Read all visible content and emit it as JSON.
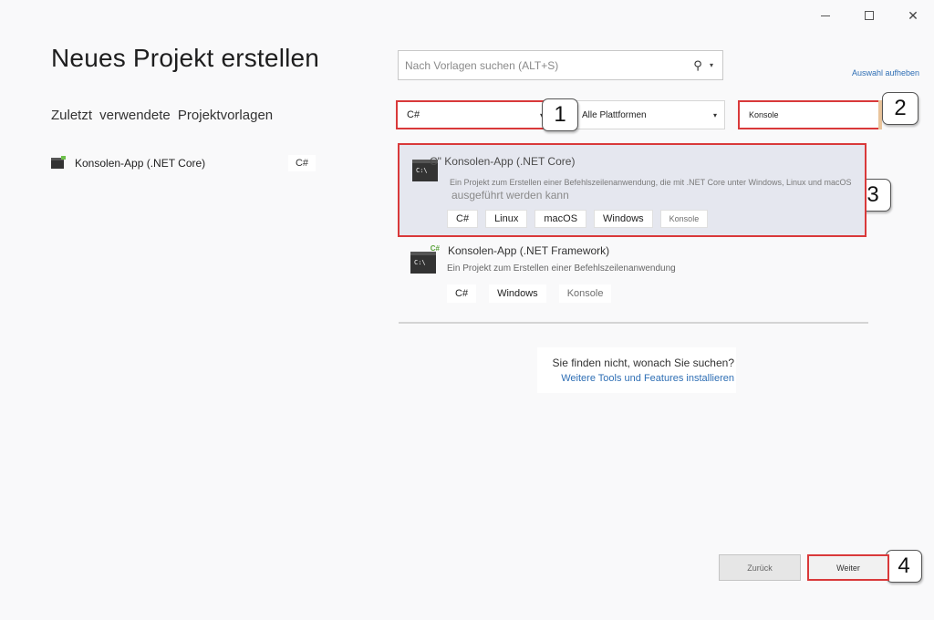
{
  "window": {
    "minimize_icon": "minimize-icon",
    "maximize_icon": "maximize-icon",
    "close_icon": "close-icon",
    "close_glyph": "✕"
  },
  "page": {
    "title": "Neues Projekt erstellen",
    "recent_heading": "Zuletzt verwendete Projektvorlagen"
  },
  "recent": [
    {
      "label": "Konsolen-App (.NET Core)",
      "tag": "C#",
      "icon": "console-app-icon"
    }
  ],
  "search": {
    "placeholder": "Nach Vorlagen suchen (ALT+S)",
    "icon": "search-icon",
    "icon_glyph": "⚲",
    "dropdown_glyph": "▾"
  },
  "clear_selection": "Auswahl aufheben",
  "filters": {
    "language": "C#",
    "platform": "Alle Plattformen",
    "project_type": "Konsole",
    "dropdown_glyph": "▾"
  },
  "callouts": [
    "1",
    "2",
    "3",
    "4"
  ],
  "templates": [
    {
      "title": "C\" Konsolen-App (.NET Core)",
      "description": "Ein Projekt zum Erstellen einer Befehlszeilenanwendung, die mit .NET Core unter Windows, Linux und macOS",
      "description_cont": "ausgeführt werden kann",
      "tags": [
        "C#",
        "Linux",
        "macOS",
        "Windows",
        "Konsole"
      ],
      "icon_prompt": "C:\\",
      "icon_lang": "C#",
      "selected": true
    },
    {
      "title": "Konsolen-App (.NET Framework)",
      "description": "Ein Projekt zum Erstellen einer Befehlszeilenanwendung",
      "tags": [
        "C#",
        "Windows",
        "Konsole"
      ],
      "icon_prompt": "C:\\",
      "icon_lang": "C#",
      "selected": false
    }
  ],
  "help": {
    "question": "Sie finden nicht, wonach Sie suchen?",
    "link": "Weitere Tools und Features installieren"
  },
  "buttons": {
    "back": "Zurück",
    "next": "Weiter"
  },
  "colors": {
    "highlight_border": "#d9393a",
    "link": "#2f6fb5",
    "selected_card_bg": "#e5e7ef"
  }
}
